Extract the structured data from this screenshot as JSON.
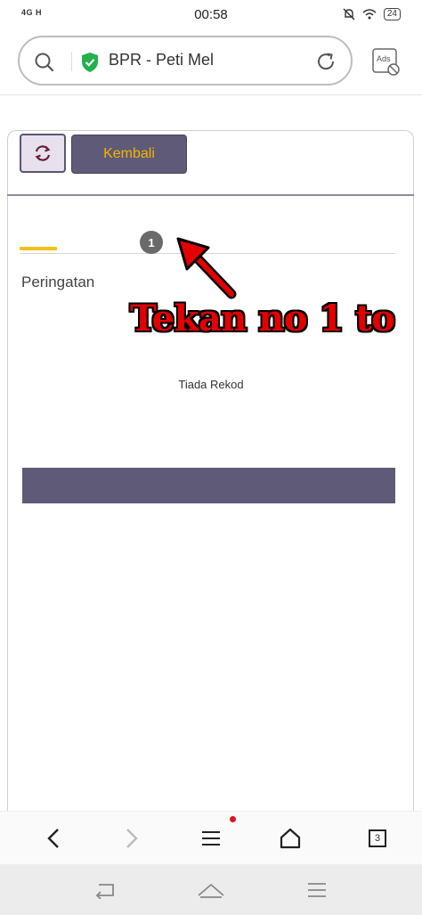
{
  "status_bar": {
    "signal": "4G  H",
    "time": "00:58",
    "battery": "24"
  },
  "browser": {
    "page_title": "BPR - Peti Mel",
    "ads_label": "Ads",
    "tab_count": "3"
  },
  "page": {
    "kembali_label": "Kembali",
    "tab_badge": "1",
    "section_title": "Peringatan",
    "empty_message": "Tiada Rekod"
  },
  "annotation": {
    "text": "Tekan no 1 to"
  },
  "colors": {
    "purple": "#5f5a78",
    "yellow": "#f2c21a",
    "annotation_red": "#e40000"
  }
}
